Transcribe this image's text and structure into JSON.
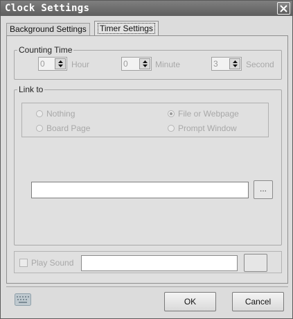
{
  "window": {
    "title": "Clock Settings"
  },
  "tabs": [
    {
      "label": "Background Settings"
    },
    {
      "label": "Timer Settings"
    }
  ],
  "counting_time": {
    "label": "Counting Time",
    "hour": {
      "value": "0",
      "unit": "Hour"
    },
    "minute": {
      "value": "0",
      "unit": "Minute"
    },
    "second": {
      "value": "3",
      "unit": "Second"
    }
  },
  "link_to": {
    "label": "Link to",
    "options": [
      {
        "label": "Nothing",
        "selected": false
      },
      {
        "label": "File or Webpage",
        "selected": true
      },
      {
        "label": "Board Page",
        "selected": false
      },
      {
        "label": "Prompt Window",
        "selected": false
      }
    ],
    "path_value": "",
    "browse_label": "..."
  },
  "sound": {
    "label": "Play Sound",
    "checked": false,
    "path_value": ""
  },
  "buttons": {
    "ok": "OK",
    "cancel": "Cancel"
  },
  "icons": {
    "close": "close-icon",
    "keyboard": "keyboard-icon",
    "spin": "spin-arrows-icon"
  },
  "colors": {
    "titlebar": "#6e6e6e",
    "disabled_text": "#a8a8a8"
  }
}
